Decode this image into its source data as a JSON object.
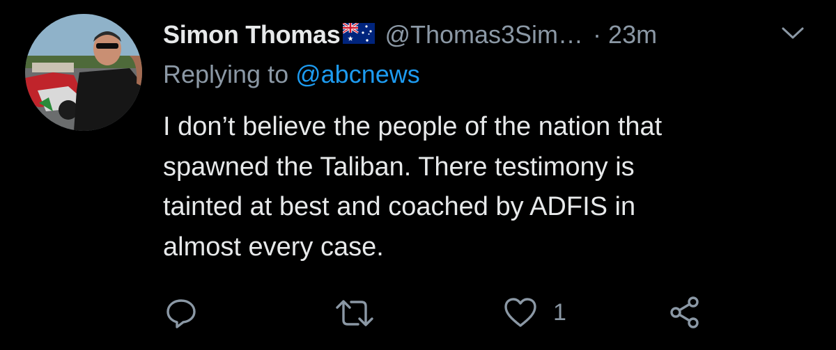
{
  "tweet": {
    "display_name": "Simon Thomas",
    "handle": "@Thomas3Sim…",
    "separator": "·",
    "time": "23m",
    "replying_prefix": "Replying to ",
    "replying_mention": "@abcnews",
    "body_lines": [
      "I don’t believe the people of the nation that",
      "spawned the Taliban. There testimony is",
      "tainted at best and coached by ADFIS in",
      "almost every case."
    ],
    "like_count": "1"
  },
  "icons": {
    "avatar": "avatar-photo",
    "flag": "australia-flag-icon",
    "menu": "chevron-down-icon",
    "reply": "reply-icon",
    "retweet": "retweet-icon",
    "like": "heart-icon",
    "share": "share-icon"
  },
  "colors": {
    "background": "#000000",
    "text": "#e7e9ea",
    "secondary": "#8b98a5",
    "link": "#1d9bf0"
  }
}
